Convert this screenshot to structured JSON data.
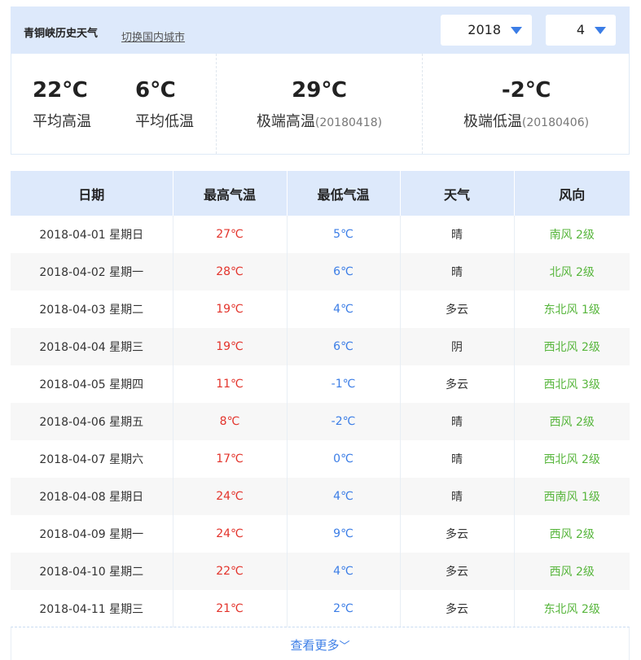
{
  "header": {
    "city_title": "青铜峡历史天气",
    "switch_link": "切换国内城市",
    "year": "2018",
    "month": "4"
  },
  "summary": {
    "avg_high": {
      "value": "22℃",
      "label": "平均高温"
    },
    "avg_low": {
      "value": "6℃",
      "label": "平均低温"
    },
    "extreme_high": {
      "value": "29℃",
      "label": "极端高温",
      "date": "(20180418)"
    },
    "extreme_low": {
      "value": "-2℃",
      "label": "极端低温",
      "date": "(20180406)"
    }
  },
  "table": {
    "headers": [
      "日期",
      "最高气温",
      "最低气温",
      "天气",
      "风向"
    ],
    "rows": [
      [
        "2018-04-01 星期日",
        "27℃",
        "5℃",
        "晴",
        "南风 2级"
      ],
      [
        "2018-04-02 星期一",
        "28℃",
        "6℃",
        "晴",
        "北风 2级"
      ],
      [
        "2018-04-03 星期二",
        "19℃",
        "4℃",
        "多云",
        "东北风 1级"
      ],
      [
        "2018-04-04 星期三",
        "19℃",
        "6℃",
        "阴",
        "西北风 2级"
      ],
      [
        "2018-04-05 星期四",
        "11℃",
        "-1℃",
        "多云",
        "西北风 3级"
      ],
      [
        "2018-04-06 星期五",
        "8℃",
        "-2℃",
        "晴",
        "西风 2级"
      ],
      [
        "2018-04-07 星期六",
        "17℃",
        "0℃",
        "晴",
        "西北风 2级"
      ],
      [
        "2018-04-08 星期日",
        "24℃",
        "4℃",
        "晴",
        "西南风 1级"
      ],
      [
        "2018-04-09 星期一",
        "24℃",
        "9℃",
        "多云",
        "西风 2级"
      ],
      [
        "2018-04-10 星期二",
        "22℃",
        "4℃",
        "多云",
        "西风 2级"
      ],
      [
        "2018-04-11 星期三",
        "21℃",
        "2℃",
        "多云",
        "东北风 2级"
      ]
    ]
  },
  "more": {
    "label": "查看更多",
    "icon": "double-chevron-down-icon"
  },
  "colors": {
    "header_bg": "#dde9fb",
    "accent_blue": "#3b7de6",
    "high_temp_red": "#e3332b",
    "wind_green": "#58b63d"
  }
}
